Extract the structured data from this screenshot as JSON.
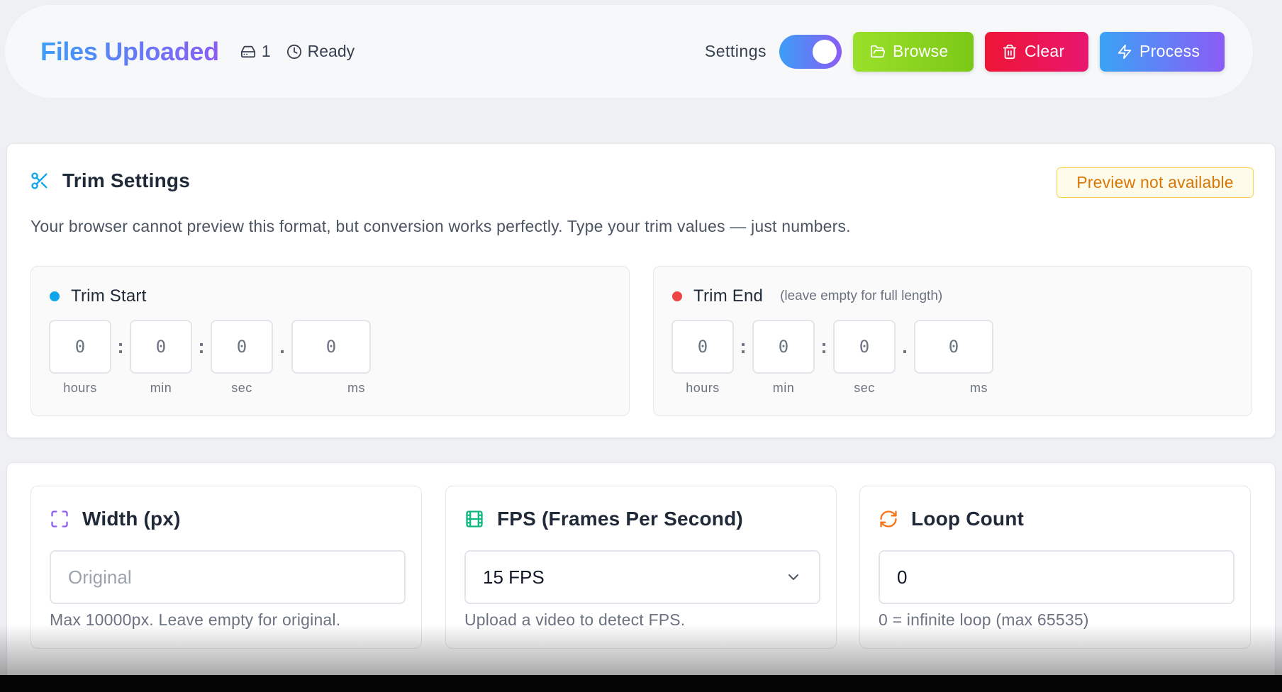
{
  "header": {
    "title": "Files Uploaded",
    "file_count": "1",
    "status": "Ready",
    "settings_label": "Settings",
    "settings_toggle_on": true,
    "browse_label": "Browse",
    "clear_label": "Clear",
    "process_label": "Process"
  },
  "trim": {
    "title": "Trim Settings",
    "badge": "Preview not available",
    "description": "Your browser cannot preview this format, but conversion works perfectly. Type your trim values — just numbers.",
    "start": {
      "title": "Trim Start",
      "hours": "0",
      "min": "0",
      "sec": "0",
      "ms": "0"
    },
    "end": {
      "title": "Trim End",
      "hint": "(leave empty for full length)",
      "hours": "0",
      "min": "0",
      "sec": "0",
      "ms": "0"
    },
    "labels": {
      "hours": "hours",
      "min": "min",
      "sec": "sec",
      "ms": "ms"
    },
    "separators": {
      "colon": ":",
      "dot": "."
    }
  },
  "options": {
    "width": {
      "title": "Width (px)",
      "placeholder": "Original",
      "help": "Max 10000px. Leave empty for original."
    },
    "fps": {
      "title": "FPS (Frames Per Second)",
      "value": "15 FPS",
      "help": "Upload a video to detect FPS."
    },
    "loop": {
      "title": "Loop Count",
      "value": "0",
      "help": "0 = infinite loop (max 65535)"
    }
  },
  "colors": {
    "accent_gradient_start": "#3b9ef6",
    "accent_gradient_end": "#8b5cf6",
    "browse": "#8fd620",
    "clear": "#ec1550",
    "badge_text": "#d97706"
  },
  "icons": {
    "file_count": "hard-drive-icon",
    "status": "clock-icon",
    "browse": "folder-open-icon",
    "clear": "trash-icon",
    "process": "lightning-icon",
    "trim": "scissors-icon",
    "width": "expand-icon",
    "fps": "film-icon",
    "loop": "refresh-icon",
    "fps_dropdown": "chevron-down-icon"
  }
}
